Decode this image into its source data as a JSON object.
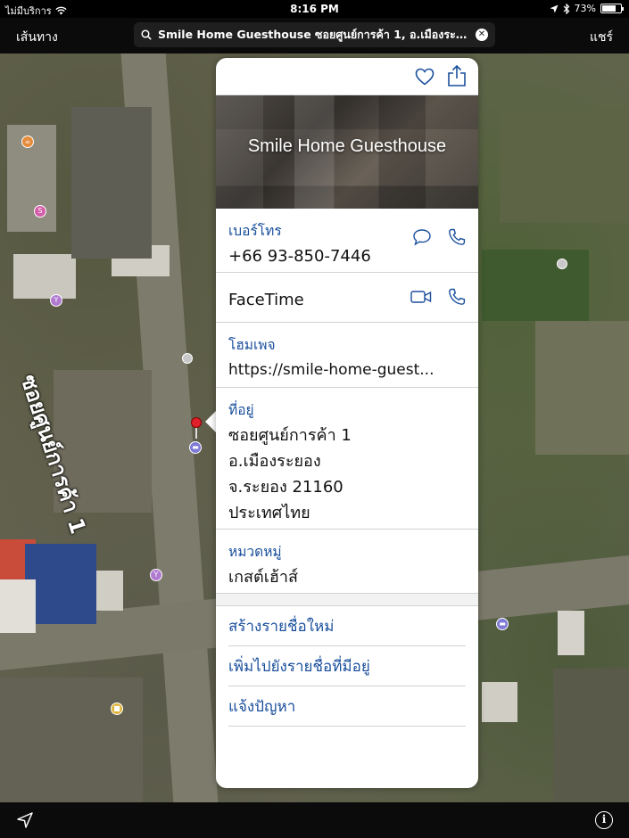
{
  "status_bar": {
    "carrier": "ไม่มีบริการ",
    "time": "8:16 PM",
    "battery_percent": "73%",
    "battery_level": 0.73
  },
  "nav": {
    "left_label": "เส้นทาง",
    "right_label": "แชร์",
    "search_query": "Smile Home Guesthouse ซอยศูนย์การค้า 1, อ.เมืองระยอง, จ.ระยอง"
  },
  "map": {
    "street_label": "ซอยศูนย์การค้า 1"
  },
  "card": {
    "title": "Smile Home Guesthouse",
    "phone": {
      "label": "เบอร์โทร",
      "value": "+66 93-850-7446"
    },
    "facetime": {
      "label": "FaceTime"
    },
    "homepage": {
      "label": "โฮมเพจ",
      "value": "https://smile-home-guest..."
    },
    "address": {
      "label": "ที่อยู่",
      "line1": "ซอยศูนย์การค้า 1",
      "line2": "อ.เมืองระยอง",
      "line3": "จ.ระยอง 21160",
      "line4": "ประเทศไทย"
    },
    "category": {
      "label": "หมวดหมู่",
      "value": "เกสต์เฮ้าส์"
    },
    "actions": {
      "create_list": "สร้างรายชื่อใหม่",
      "add_to_list": "เพิ่มไปยังรายชื่อที่มีอยู่",
      "report": "แจ้งปัญหา"
    }
  },
  "colors": {
    "accent": "#1a4f9c",
    "pin": "#e0202a"
  }
}
